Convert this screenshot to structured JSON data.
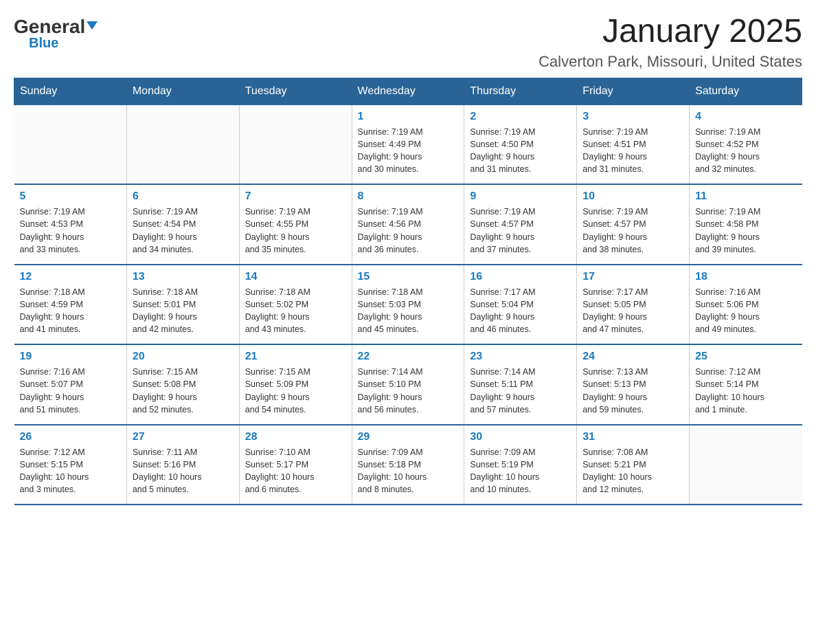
{
  "logo": {
    "general": "General",
    "blue": "Blue"
  },
  "header": {
    "month_year": "January 2025",
    "location": "Calverton Park, Missouri, United States"
  },
  "weekdays": [
    "Sunday",
    "Monday",
    "Tuesday",
    "Wednesday",
    "Thursday",
    "Friday",
    "Saturday"
  ],
  "weeks": [
    [
      {
        "day": "",
        "info": ""
      },
      {
        "day": "",
        "info": ""
      },
      {
        "day": "",
        "info": ""
      },
      {
        "day": "1",
        "info": "Sunrise: 7:19 AM\nSunset: 4:49 PM\nDaylight: 9 hours\nand 30 minutes."
      },
      {
        "day": "2",
        "info": "Sunrise: 7:19 AM\nSunset: 4:50 PM\nDaylight: 9 hours\nand 31 minutes."
      },
      {
        "day": "3",
        "info": "Sunrise: 7:19 AM\nSunset: 4:51 PM\nDaylight: 9 hours\nand 31 minutes."
      },
      {
        "day": "4",
        "info": "Sunrise: 7:19 AM\nSunset: 4:52 PM\nDaylight: 9 hours\nand 32 minutes."
      }
    ],
    [
      {
        "day": "5",
        "info": "Sunrise: 7:19 AM\nSunset: 4:53 PM\nDaylight: 9 hours\nand 33 minutes."
      },
      {
        "day": "6",
        "info": "Sunrise: 7:19 AM\nSunset: 4:54 PM\nDaylight: 9 hours\nand 34 minutes."
      },
      {
        "day": "7",
        "info": "Sunrise: 7:19 AM\nSunset: 4:55 PM\nDaylight: 9 hours\nand 35 minutes."
      },
      {
        "day": "8",
        "info": "Sunrise: 7:19 AM\nSunset: 4:56 PM\nDaylight: 9 hours\nand 36 minutes."
      },
      {
        "day": "9",
        "info": "Sunrise: 7:19 AM\nSunset: 4:57 PM\nDaylight: 9 hours\nand 37 minutes."
      },
      {
        "day": "10",
        "info": "Sunrise: 7:19 AM\nSunset: 4:57 PM\nDaylight: 9 hours\nand 38 minutes."
      },
      {
        "day": "11",
        "info": "Sunrise: 7:19 AM\nSunset: 4:58 PM\nDaylight: 9 hours\nand 39 minutes."
      }
    ],
    [
      {
        "day": "12",
        "info": "Sunrise: 7:18 AM\nSunset: 4:59 PM\nDaylight: 9 hours\nand 41 minutes."
      },
      {
        "day": "13",
        "info": "Sunrise: 7:18 AM\nSunset: 5:01 PM\nDaylight: 9 hours\nand 42 minutes."
      },
      {
        "day": "14",
        "info": "Sunrise: 7:18 AM\nSunset: 5:02 PM\nDaylight: 9 hours\nand 43 minutes."
      },
      {
        "day": "15",
        "info": "Sunrise: 7:18 AM\nSunset: 5:03 PM\nDaylight: 9 hours\nand 45 minutes."
      },
      {
        "day": "16",
        "info": "Sunrise: 7:17 AM\nSunset: 5:04 PM\nDaylight: 9 hours\nand 46 minutes."
      },
      {
        "day": "17",
        "info": "Sunrise: 7:17 AM\nSunset: 5:05 PM\nDaylight: 9 hours\nand 47 minutes."
      },
      {
        "day": "18",
        "info": "Sunrise: 7:16 AM\nSunset: 5:06 PM\nDaylight: 9 hours\nand 49 minutes."
      }
    ],
    [
      {
        "day": "19",
        "info": "Sunrise: 7:16 AM\nSunset: 5:07 PM\nDaylight: 9 hours\nand 51 minutes."
      },
      {
        "day": "20",
        "info": "Sunrise: 7:15 AM\nSunset: 5:08 PM\nDaylight: 9 hours\nand 52 minutes."
      },
      {
        "day": "21",
        "info": "Sunrise: 7:15 AM\nSunset: 5:09 PM\nDaylight: 9 hours\nand 54 minutes."
      },
      {
        "day": "22",
        "info": "Sunrise: 7:14 AM\nSunset: 5:10 PM\nDaylight: 9 hours\nand 56 minutes."
      },
      {
        "day": "23",
        "info": "Sunrise: 7:14 AM\nSunset: 5:11 PM\nDaylight: 9 hours\nand 57 minutes."
      },
      {
        "day": "24",
        "info": "Sunrise: 7:13 AM\nSunset: 5:13 PM\nDaylight: 9 hours\nand 59 minutes."
      },
      {
        "day": "25",
        "info": "Sunrise: 7:12 AM\nSunset: 5:14 PM\nDaylight: 10 hours\nand 1 minute."
      }
    ],
    [
      {
        "day": "26",
        "info": "Sunrise: 7:12 AM\nSunset: 5:15 PM\nDaylight: 10 hours\nand 3 minutes."
      },
      {
        "day": "27",
        "info": "Sunrise: 7:11 AM\nSunset: 5:16 PM\nDaylight: 10 hours\nand 5 minutes."
      },
      {
        "day": "28",
        "info": "Sunrise: 7:10 AM\nSunset: 5:17 PM\nDaylight: 10 hours\nand 6 minutes."
      },
      {
        "day": "29",
        "info": "Sunrise: 7:09 AM\nSunset: 5:18 PM\nDaylight: 10 hours\nand 8 minutes."
      },
      {
        "day": "30",
        "info": "Sunrise: 7:09 AM\nSunset: 5:19 PM\nDaylight: 10 hours\nand 10 minutes."
      },
      {
        "day": "31",
        "info": "Sunrise: 7:08 AM\nSunset: 5:21 PM\nDaylight: 10 hours\nand 12 minutes."
      },
      {
        "day": "",
        "info": ""
      }
    ]
  ]
}
